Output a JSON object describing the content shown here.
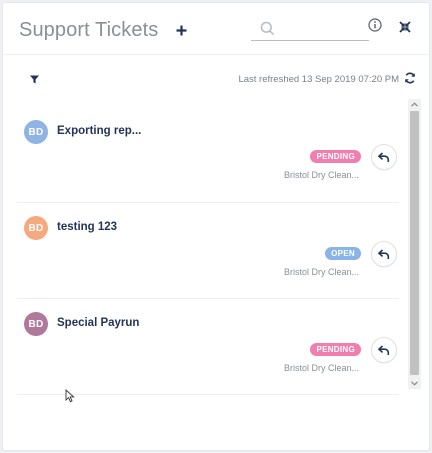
{
  "header": {
    "title": "Support Tickets",
    "add_icon": "plus-icon",
    "search": {
      "placeholder": "",
      "value": "",
      "icon": "search-icon"
    },
    "info_icon": "info-icon",
    "collapse_icon": "collapse-arrows-icon"
  },
  "toolbar": {
    "filter_icon": "filter-icon",
    "last_refreshed": "Last refreshed 13 Sep 2019 07:20 PM",
    "refresh_icon": "refresh-icon"
  },
  "tickets": [
    {
      "initials": "BD",
      "avatar_color": "#8fb3e3",
      "subject": "Exporting rep...",
      "status": "PENDING",
      "status_color": "#f07fb0",
      "company": "Bristol Dry Clean...",
      "reply_icon": "reply-icon"
    },
    {
      "initials": "BD",
      "avatar_color": "#f5a97f",
      "subject": "testing 123",
      "status": "OPEN",
      "status_color": "#8ab4e8",
      "company": "Bristol Dry Clean...",
      "reply_icon": "reply-icon"
    },
    {
      "initials": "BD",
      "avatar_color": "#b0789a",
      "subject": "Special Payrun",
      "status": "PENDING",
      "status_color": "#f07fb0",
      "company": "Bristol Dry Clean...",
      "reply_icon": "reply-icon"
    }
  ],
  "colors": {
    "accent": "#243458",
    "muted_text": "#8a8f97"
  }
}
